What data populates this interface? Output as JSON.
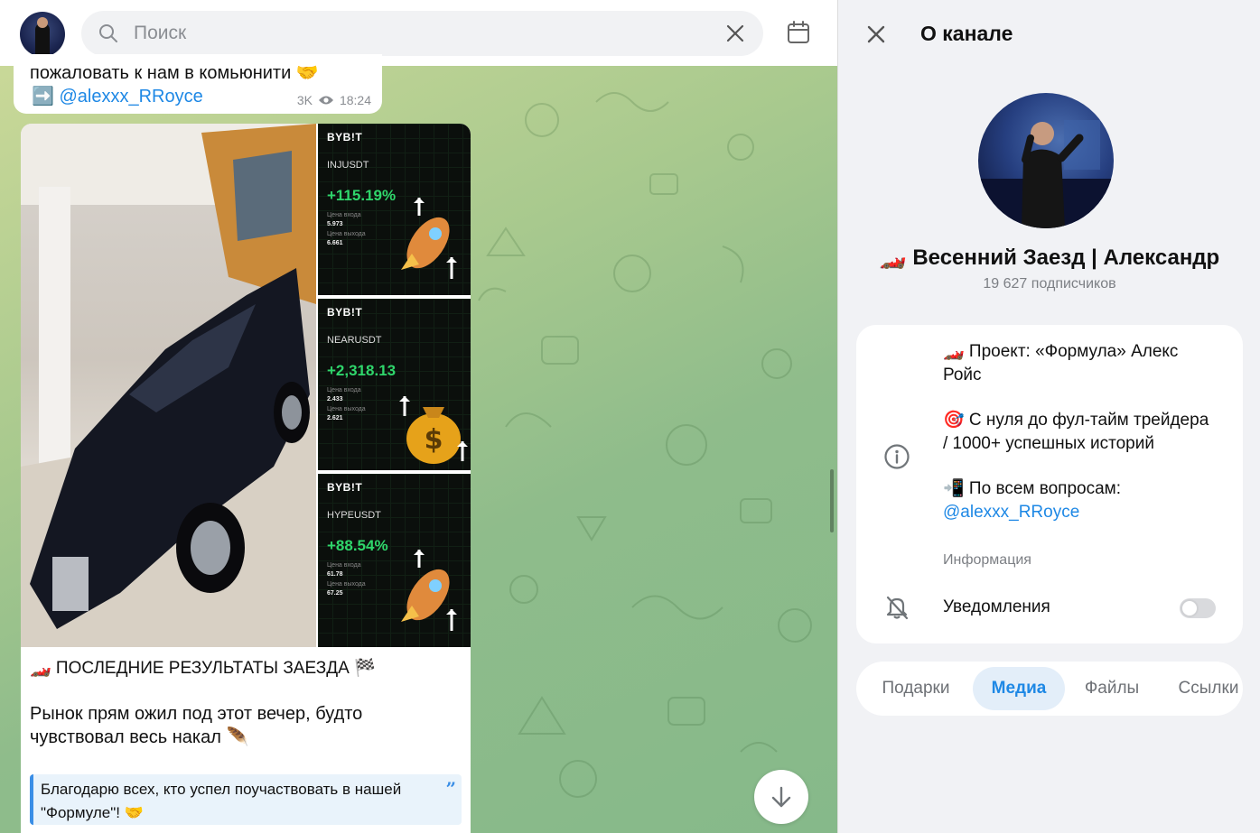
{
  "search": {
    "placeholder": "Поиск"
  },
  "chat": {
    "prev_message": {
      "text": "пожаловать к нам в комьюнити 🤝",
      "mention": "➡️ @alexxx_RRoyce",
      "views": "3K",
      "time": "18:24"
    },
    "post": {
      "screens": [
        {
          "brand": "BYB!T",
          "pair": "INJUSDT",
          "pnl": "+115.19%",
          "label1": "Цена входа",
          "value1": "5.973",
          "label2": "Цена выхода",
          "value2": "6.661"
        },
        {
          "brand": "BYB!T",
          "pair": "NEARUSDT",
          "pnl": "+2,318.13",
          "label1": "Цена входа",
          "value1": "2.433",
          "label2": "Цена выхода",
          "value2": "2.621"
        },
        {
          "brand": "BYB!T",
          "pair": "HYPEUSDT",
          "pnl": "+88.54%",
          "label1": "Цена входа",
          "value1": "61.78",
          "label2": "Цена выхода",
          "value2": "67.25"
        }
      ],
      "headline": "🏎️ ПОСЛЕДНИЕ РЕЗУЛЬТАТЫ ЗАЕЗДА 🏁",
      "body": "Рынок прям ожил под этот вечер, будто чувствовал весь накал 🪶",
      "quote": "Благодарю всех, кто успел поучаствовать в нашей \"Формуле\"! 🤝"
    }
  },
  "side": {
    "title": "О канале",
    "channel_name": "🏎️ Весенний Заезд | Александр",
    "subscribers": "19 627 подписчиков",
    "description": {
      "line1": "🏎️ Проект: «Формула» Алекс Ройс",
      "line2": "🎯 С нуля до фул-тайм трейдера / 1000+ успешных историй",
      "line3": "📲 По всем вопросам:",
      "link": "@alexxx_RRoyce",
      "label": "Информация"
    },
    "notifications": {
      "label": "Уведомления",
      "enabled": false
    },
    "tabs": [
      {
        "label": "Подарки",
        "active": false
      },
      {
        "label": "Медиа",
        "active": true
      },
      {
        "label": "Файлы",
        "active": false
      },
      {
        "label": "Ссылки",
        "active": false
      }
    ]
  },
  "colors": {
    "accent": "#1e88e5",
    "profit": "#2fd66b",
    "wallpaper": "#8fbc8b"
  }
}
